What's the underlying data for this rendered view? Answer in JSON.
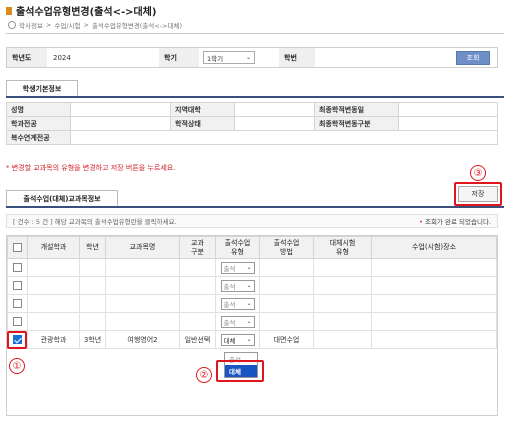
{
  "page": {
    "title": "출석수업유형변경(출석<->대체)",
    "breadcrumb": [
      "학사정보",
      "수업/시험",
      "출석수업유형변경(출석<->대체)"
    ],
    "breadcrumb_sep": ">"
  },
  "search": {
    "year_label": "학년도",
    "year_value": "2024",
    "term_label": "학기",
    "term_value": "1학기",
    "id_label": "학번",
    "id_value": "",
    "search_button": "조회"
  },
  "student_tab": "학생기본정보",
  "student_info": {
    "name_label": "성명",
    "region_label": "지역대학",
    "last_change_date_label": "최종학적변동일",
    "major_label": "학과전공",
    "status_label": "학적상태",
    "last_change_type_label": "최종학적변동구분",
    "double_major_label": "복수연계전공"
  },
  "notice": "* 변경할 교과목의 유형을 변경하고 저장 버튼을 누르세요.",
  "course_tab": "출석수업(대체)교과목정보",
  "save_button": "저장",
  "annotations": {
    "one": "①",
    "two": "②",
    "three": "③"
  },
  "countbar": {
    "count_text": "[ 건수 : 5 건 ] 해당 교과목의 출석수업유형란을 클릭하세요.",
    "done_dot": "•",
    "done_text": "조회가 완료 되었습니다."
  },
  "grid": {
    "headers": [
      "개설학과",
      "학년",
      "교과목명",
      "교과\n구분",
      "출석수업\n유형",
      "출석수업\n방법",
      "대체시험\n유형",
      "수업(시험)장소"
    ],
    "rows": [
      {
        "checked": false,
        "dept": "",
        "year": "",
        "course": "",
        "div": "",
        "type": "출석",
        "method": "",
        "alt": "",
        "place": ""
      },
      {
        "checked": false,
        "dept": "",
        "year": "",
        "course": "",
        "div": "",
        "type": "출석",
        "method": "",
        "alt": "",
        "place": ""
      },
      {
        "checked": false,
        "dept": "",
        "year": "",
        "course": "",
        "div": "",
        "type": "출석",
        "method": "",
        "alt": "",
        "place": ""
      },
      {
        "checked": false,
        "dept": "",
        "year": "",
        "course": "",
        "div": "",
        "type": "출석",
        "method": "",
        "alt": "",
        "place": ""
      },
      {
        "checked": true,
        "dept": "관광학과",
        "year": "3학년",
        "course": "여행영어2",
        "div": "일반선택",
        "type": "대체",
        "method": "대면수업",
        "alt": "",
        "place": ""
      }
    ]
  },
  "dropdown": {
    "options": [
      "출석",
      "대체"
    ],
    "selected": "대체"
  },
  "colors": {
    "accent_red": "#e0161f",
    "search_button": "#6f8fc7",
    "selected_option": "#1a55c4",
    "title_bullet": "#d98a1a"
  }
}
